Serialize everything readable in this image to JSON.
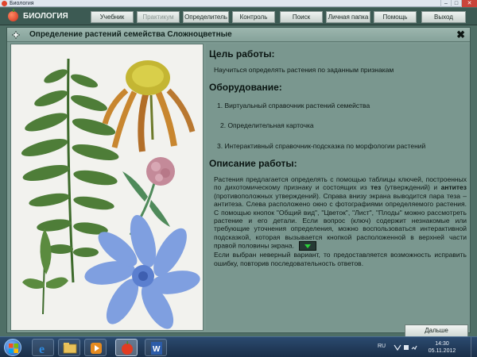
{
  "window": {
    "title": "Биология",
    "min": "–",
    "max": "□",
    "close": "✕"
  },
  "menubar": {
    "app_title": "БИОЛОГИЯ",
    "buttons": [
      {
        "label": "Учебник",
        "enabled": true
      },
      {
        "label": "Практикум",
        "enabled": false
      },
      {
        "label": "Определитель",
        "enabled": true
      },
      {
        "label": "Контроль",
        "enabled": true
      },
      {
        "label": "Поиск",
        "enabled": true
      },
      {
        "label": "Личная папка",
        "enabled": true
      },
      {
        "label": "Помощь",
        "enabled": true
      },
      {
        "label": "Выход",
        "enabled": true
      }
    ]
  },
  "panel": {
    "title": "Определение растений семейства Сложноцветные",
    "close": "✖",
    "goal_heading": "Цель работы:",
    "goal_text": "Научиться определять растения по заданным признакам",
    "equipment_heading": "Оборудование:",
    "equipment_items": [
      "1. Виртуальный справочник растений семейства",
      "2. Определительная карточка",
      "3. Интерактивный справочник-подсказка по морфологии растений"
    ],
    "description_heading": "Описание работы:",
    "description": {
      "p1_a": "Растения предлагается определять с помощью таблицы ключей, построенных по дихотомическому признаку и состоящих из ",
      "p1_b": "тез",
      "p1_c": " (утверждений) и ",
      "p1_d": "антитез",
      "p1_e": " (противоположных утверждений). Справа внизу экрана выводится пара теза – антитеза. Слева расположено окно с фотографиями определяемого растения. С помощью кнопок \"Общий вид\", \"Цветок\", \"Лист\", \"Плоды\" можно рассмотреть растение и его детали. Если вопрос (ключ) содержит незнакомые или требующие уточнения определения, можно воспользоваться интерактивной подсказкой, которая вызывается кнопкой расположенной в верхней части правой половины экрана.",
      "p2": "Если выбран неверный вариант, то предоставляется возможность исправить ошибку, повторив последовательность ответов."
    },
    "next_button": "Дальше"
  },
  "taskbar": {
    "language": "RU",
    "time": "14:30",
    "date": "05.11.2012"
  },
  "colors": {
    "desktop": "#4f6f66",
    "panel": "#7d9a92",
    "hint_arrow": "#2ad23a"
  }
}
